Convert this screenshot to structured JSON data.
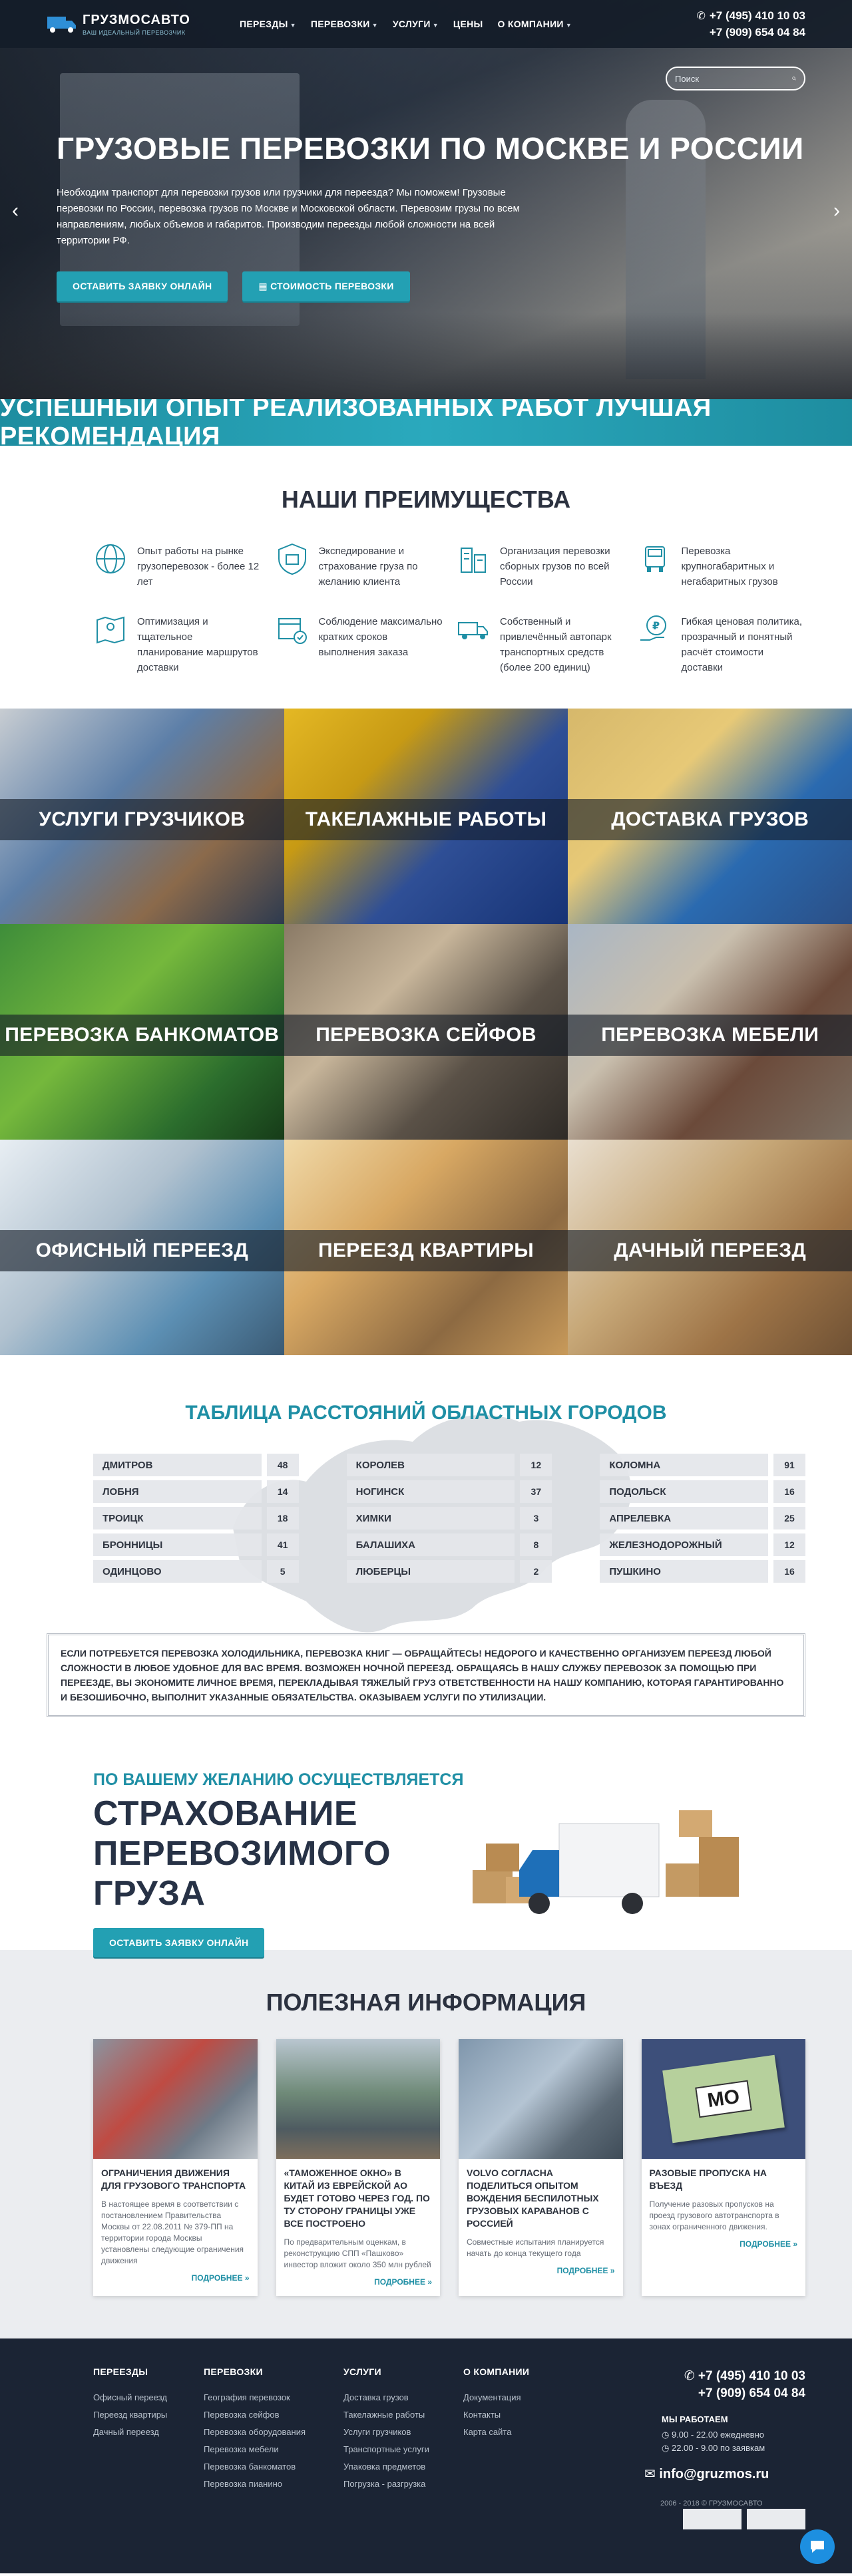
{
  "header": {
    "logo_name": "ГРУЗМОСАВТО",
    "logo_sub": "ВАШ ИДЕАЛЬНЫЙ ПЕРЕВОЗЧИК",
    "nav": [
      {
        "label": "ПЕРЕЗДЫ",
        "dropdown": true
      },
      {
        "label": "ПЕРЕВОЗКИ",
        "dropdown": true
      },
      {
        "label": "УСЛУГИ",
        "dropdown": true
      },
      {
        "label": "ЦЕНЫ",
        "dropdown": false
      },
      {
        "label": "О КОМПАНИИ",
        "dropdown": true
      }
    ],
    "phone1": "+7 (495) 410 10 03",
    "phone2": "+7 (909) 654 04 84"
  },
  "hero": {
    "search_placeholder": "Поиск",
    "title": "ГРУЗОВЫЕ ПЕРЕВОЗКИ ПО МОСКВЕ И РОССИИ",
    "text": "Необходим транспорт для перевозки грузов или грузчики для переезда? Мы поможем! Грузовые перевозки по России, перевозка грузов по Москве и Московской области. Перевозим грузы по всем направлениям, любых объемов и габаритов. Производим переезды любой сложности на всей территории РФ.",
    "btn_order": "ОСТАВИТЬ ЗАЯВКУ ОНЛАЙН",
    "btn_price": "СТОИМОСТЬ ПЕРЕВОЗКИ"
  },
  "banner": "УСПЕШНЫЙ ОПЫТ РЕАЛИЗОВАННЫХ РАБОТ ЛУЧШАЯ РЕКОМЕНДАЦИЯ",
  "advantages": {
    "title": "НАШИ ПРЕИМУЩЕСТВА",
    "items": [
      {
        "text": "Опыт работы на рынке грузоперевозок - более 12 лет",
        "icon": "globe-icon"
      },
      {
        "text": "Экспедирование и страхование груза по желанию клиента",
        "icon": "shield-box-icon"
      },
      {
        "text": "Организация перевозки сборных грузов по всей России",
        "icon": "building-icon"
      },
      {
        "text": "Перевозка крупногабаритных и негабаритных грузов",
        "icon": "truck-front-icon"
      },
      {
        "text": "Оптимизация и тщательное планирование маршрутов доставки",
        "icon": "map-pin-icon"
      },
      {
        "text": "Соблюдение максимально кратких сроков выполнения заказа",
        "icon": "calendar-check-icon"
      },
      {
        "text": "Собственный и привлечённый автопарк транспортных средств (более 200 единиц)",
        "icon": "delivery-truck-icon"
      },
      {
        "text": "Гибкая ценовая политика, прозрачный и понятный расчёт стоимости доставки",
        "icon": "ruble-hand-icon"
      }
    ]
  },
  "services": [
    {
      "label": "УСЛУГИ ГРУЗЧИКОВ"
    },
    {
      "label": "ТАКЕЛАЖНЫЕ РАБОТЫ"
    },
    {
      "label": "ДОСТАВКА ГРУЗОВ"
    },
    {
      "label": "ПЕРЕВОЗКА БАНКОМАТОВ"
    },
    {
      "label": "ПЕРЕВОЗКА СЕЙФОВ"
    },
    {
      "label": "ПЕРЕВОЗКА МЕБЕЛИ"
    },
    {
      "label": "ОФИСНЫЙ ПЕРЕЕЗД"
    },
    {
      "label": "ПЕРЕЕЗД КВАРТИРЫ"
    },
    {
      "label": "ДАЧНЫЙ ПЕРЕЕЗД"
    }
  ],
  "distances": {
    "title": "ТАБЛИЦА РАССТОЯНИЙ ОБЛАСТНЫХ ГОРОДОВ",
    "columns": [
      [
        {
          "city": "Дмитров",
          "km": "48"
        },
        {
          "city": "Лобня",
          "km": "14"
        },
        {
          "city": "Троицк",
          "km": "18"
        },
        {
          "city": "Бронницы",
          "km": "41"
        },
        {
          "city": "Одинцово",
          "km": "5"
        }
      ],
      [
        {
          "city": "Королев",
          "km": "12"
        },
        {
          "city": "Ногинск",
          "km": "37"
        },
        {
          "city": "Химки",
          "km": "3"
        },
        {
          "city": "Балашиха",
          "km": "8"
        },
        {
          "city": "Люберцы",
          "km": "2"
        }
      ],
      [
        {
          "city": "Коломна",
          "km": "91"
        },
        {
          "city": "Подольск",
          "km": "16"
        },
        {
          "city": "Апрелевка",
          "km": "25"
        },
        {
          "city": "Железнодорожный",
          "km": "12"
        },
        {
          "city": "Пушкино",
          "km": "16"
        }
      ]
    ]
  },
  "notice": "ЕСЛИ ПОТРЕБУЕТСЯ ПЕРЕВОЗКА ХОЛОДИЛЬНИКА, ПЕРЕВОЗКА КНИГ — ОБРАЩАЙТЕСЬ! НЕДОРОГО И КАЧЕСТВЕННО ОРГАНИЗУЕМ ПЕРЕЕЗД ЛЮБОЙ СЛОЖНОСТИ В ЛЮБОЕ УДОБНОЕ ДЛЯ ВАС ВРЕМЯ. ВОЗМОЖЕН НОЧНОЙ ПЕРЕЕЗД. ОБРАЩАЯСЬ В НАШУ СЛУЖБУ ПЕРЕВОЗОК ЗА ПОМОЩЬЮ ПРИ ПЕРЕЕЗДЕ, ВЫ ЭКОНОМИТЕ ЛИЧНОЕ ВРЕМЯ, ПЕРЕКЛАДЫВАЯ ТЯЖЕЛЫЙ ГРУЗ ОТВЕТСТВЕННОСТИ НА НАШУ КОМПАНИЮ, КОТОРАЯ ГАРАНТИРОВАННО И БЕЗОШИБОЧНО, ВЫПОЛНИТ УКАЗАННЫЕ ОБЯЗАТЕЛЬСТВА. ОКАЗЫВАЕМ УСЛУГИ ПО УТИЛИЗАЦИИ.",
  "insurance": {
    "sub": "ПО ВАШЕМУ ЖЕЛАНИЮ ОСУЩЕСТВЛЯЕТСЯ",
    "title": "СТРАХОВАНИЕ ПЕРЕВОЗИМОГО ГРУЗА",
    "btn": "ОСТАВИТЬ ЗАЯВКУ ОНЛАЙН"
  },
  "info": {
    "title": "ПОЛЕЗНАЯ ИНФОРМАЦИЯ",
    "more": "ПОДРОБНЕЕ »",
    "pass_label": "МО",
    "cards": [
      {
        "title": "ОГРАНИЧЕНИЯ ДВИЖЕНИЯ ДЛЯ ГРУЗОВОГО ТРАНСПОРТА",
        "text": "В настоящее время в соответствии с постановлением Правительства Москвы от 22.08.2011 № 379-ПП на территории города Москвы установлены следующие ограничения движения"
      },
      {
        "title": "«ТАМОЖЕННОЕ ОКНО» В КИТАЙ ИЗ ЕВРЕЙСКОЙ АО БУДЕТ ГОТОВО ЧЕРЕЗ ГОД. ПО ТУ СТОРОНУ ГРАНИЦЫ УЖЕ ВСЕ ПОСТРОЕНО",
        "text": "По предварительным оценкам, в реконструкцию СПП «Пашково» инвестор вложит около 350 млн рублей"
      },
      {
        "title": "VOLVO СОГЛАСНА ПОДЕЛИТЬСЯ ОПЫТОМ ВОЖДЕНИЯ БЕСПИЛОТНЫХ ГРУЗОВЫХ КАРАВАНОВ С РОССИЕЙ",
        "text": "Совместные испытания планируется начать до конца текущего года"
      },
      {
        "title": "РАЗОВЫЕ ПРОПУСКА НА ВЪЕЗД",
        "text": "Получение разовых пропусков на проезд грузового автотранспорта в зонах ограниченного движения."
      }
    ]
  },
  "footer": {
    "columns": [
      {
        "head": "ПЕРЕЕЗДЫ",
        "links": [
          "Офисный переезд",
          "Переезд квартиры",
          "Дачный переезд"
        ]
      },
      {
        "head": "ПЕРЕВОЗКИ",
        "links": [
          "География перевозок",
          "Перевозка сейфов",
          "Перевозка оборудования",
          "Перевозка мебели",
          "Перевозка банкоматов",
          "Перевозка пианино"
        ]
      },
      {
        "head": "УСЛУГИ",
        "links": [
          "Доставка грузов",
          "Такелажные работы",
          "Услуги грузчиков",
          "Транспортные услуги",
          "Упаковка предметов",
          "Погрузка - разгрузка"
        ]
      },
      {
        "head": "О КОМПАНИИ",
        "links": [
          "Документация",
          "Контакты",
          "Карта сайта"
        ]
      }
    ],
    "phone1": "+7 (495) 410 10 03",
    "phone2": "+7 (909) 654 04 84",
    "work_title": "МЫ РАБОТАЕМ",
    "work_day": "9.00 - 22.00 ежедневно",
    "work_night": "22.00 - 9.00 по заявкам",
    "email": "info@gruzmos.ru",
    "copyright": "2006 - 2018 © ГРУЗМОСАВТО"
  },
  "colors": {
    "accent": "#23a0b3",
    "dark": "#1b2434",
    "heading": "#2c3240"
  }
}
